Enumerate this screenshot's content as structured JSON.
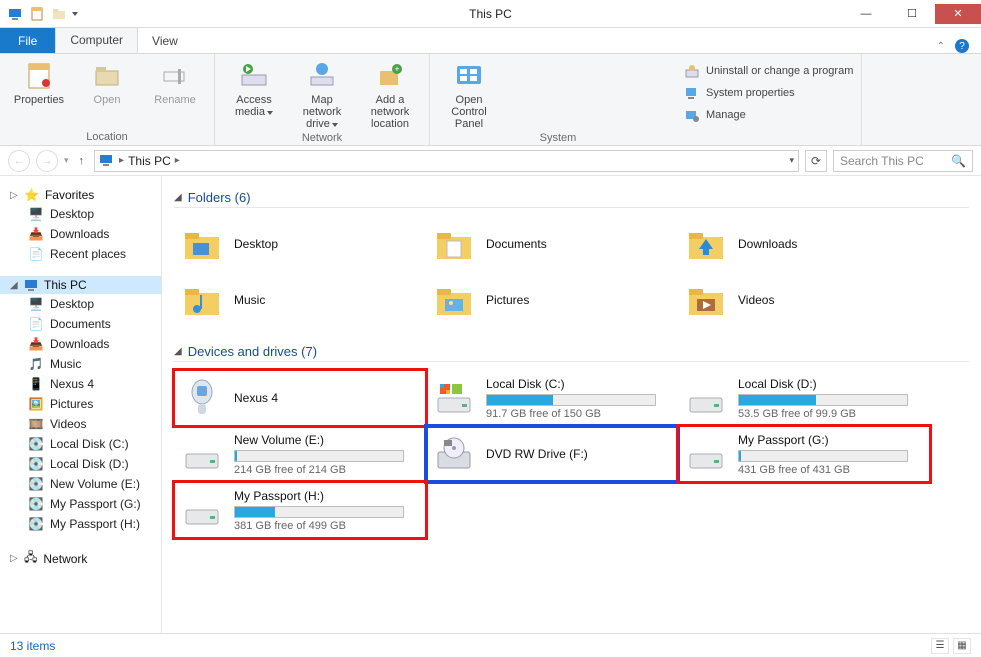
{
  "window": {
    "title": "This PC"
  },
  "tabs": {
    "file": "File",
    "computer": "Computer",
    "view": "View"
  },
  "ribbon": {
    "location": {
      "properties": "Properties",
      "open": "Open",
      "rename": "Rename",
      "label": "Location"
    },
    "network": {
      "access_media": "Access media",
      "map_drive": "Map network drive",
      "add_location": "Add a network location",
      "label": "Network"
    },
    "system_group": {
      "open_control_panel": "Open Control Panel",
      "uninstall": "Uninstall or change a program",
      "properties": "System properties",
      "manage": "Manage",
      "label": "System"
    }
  },
  "breadcrumb": {
    "root": "This PC"
  },
  "search": {
    "placeholder": "Search This PC"
  },
  "nav": {
    "favorites": {
      "label": "Favorites",
      "items": [
        "Desktop",
        "Downloads",
        "Recent places"
      ]
    },
    "thispc": {
      "label": "This PC",
      "items": [
        "Desktop",
        "Documents",
        "Downloads",
        "Music",
        "Nexus 4",
        "Pictures",
        "Videos",
        "Local Disk (C:)",
        "Local Disk (D:)",
        "New Volume (E:)",
        "My Passport (G:)",
        "My Passport (H:)"
      ]
    },
    "network": {
      "label": "Network"
    }
  },
  "folders": {
    "header": "Folders (6)",
    "items": [
      "Desktop",
      "Documents",
      "Downloads",
      "Music",
      "Pictures",
      "Videos"
    ]
  },
  "drives": {
    "header": "Devices and drives (7)",
    "items": [
      {
        "name": "Nexus 4",
        "type": "device",
        "highlight": "red"
      },
      {
        "name": "Local Disk (C:)",
        "type": "drive",
        "free": "91.7 GB free of 150 GB",
        "fill_pct": 39
      },
      {
        "name": "Local Disk (D:)",
        "type": "drive",
        "free": "53.5 GB free of 99.9 GB",
        "fill_pct": 46
      },
      {
        "name": "New Volume (E:)",
        "type": "drive",
        "free": "214 GB free of 214 GB",
        "fill_pct": 1
      },
      {
        "name": "DVD RW Drive (F:)",
        "type": "optical",
        "highlight": "blue"
      },
      {
        "name": "My Passport (G:)",
        "type": "drive",
        "free": "431 GB free of 431 GB",
        "fill_pct": 1,
        "highlight": "red"
      },
      {
        "name": "My Passport (H:)",
        "type": "drive",
        "free": "381 GB free of 499 GB",
        "fill_pct": 24,
        "highlight": "red"
      }
    ]
  },
  "status": {
    "text": "13 items"
  }
}
